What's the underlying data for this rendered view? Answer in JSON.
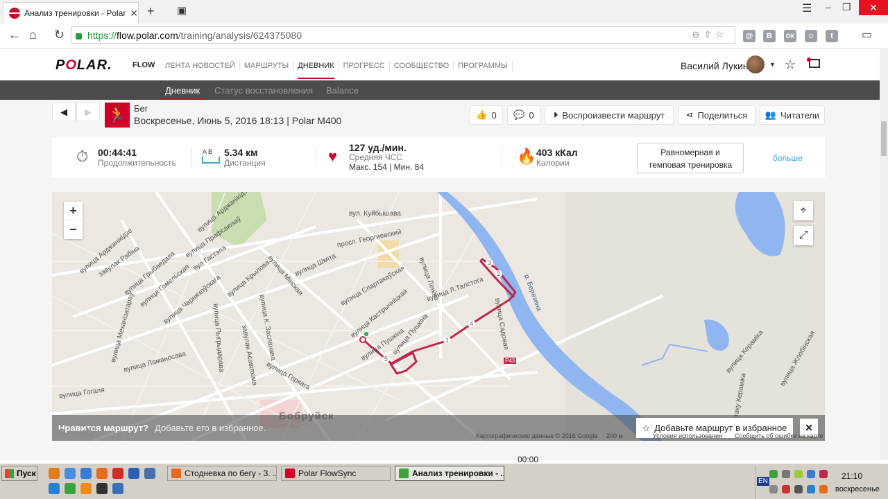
{
  "browser": {
    "tab_title": "Анализ тренировки - Polar F",
    "url_https": "https://",
    "url_host": "flow.polar.com",
    "url_path": "/training/analysis/624375080",
    "ext_letters": [
      "@",
      "В",
      "ОК",
      "",
      ""
    ]
  },
  "header": {
    "logo_pre": "P",
    "logo_o": "O",
    "logo_post": "LAR.",
    "flow": "FLOW",
    "nav": [
      "ЛЕНТА НОВОСТЕЙ",
      "МАРШРУТЫ",
      "ДНЕВНИК",
      "ПРОГРЕСС",
      "СООБЩЕСТВО",
      "ПРОГРАММЫ"
    ],
    "user_name": "Василий Лукин"
  },
  "subnav": [
    "Дневник",
    "Статус восстановления",
    "Balance"
  ],
  "session": {
    "sport": "Бег",
    "info": "Воскресенье, Июнь 5, 2016 18:13 | Polar M400",
    "likes": "0",
    "comments": "0",
    "replay_label": "Воспроизвести маршрут",
    "share_label": "Поделиться",
    "readers_label": "Читатели"
  },
  "summary": {
    "duration": "00:44:41",
    "duration_label": "Продолжительность",
    "distance": "5.34 км",
    "distance_label": "Дистанция",
    "ab_label": "A  B",
    "hr": "127 уд./мин.",
    "hr_label": "Средняя ЧСС",
    "hr_range": "Макс. 154  |  Мин. 84",
    "calories": "403 кКал",
    "calories_label": "Калории",
    "benefit_line1": "Равномерная и",
    "benefit_line2": "темповая тренировка",
    "more": "больше"
  },
  "map": {
    "city": "Бобруйск",
    "streets": [
      "просп. Георгиевский",
      "вулица Мінская",
      "вулица Кастрычніцкая",
      "вулица Спартакаўская",
      "вулица Пушкіна",
      "вулица Леніна",
      "вулица Л.Талстога",
      "вулица Крылова",
      "вулица Гогаля",
      "вулица Ламаносава",
      "вулица Горкага",
      "вулица Шміта",
      "вул. Куйбышава",
      "вулица Гомельская",
      "вулица Чарняхоўскага",
      "вулица Грыбаедава",
      "завулак Рабіна",
      "вулица Арджанікідзе",
      "вул Гастэла",
      "вулица Пушкіна",
      "вулица К. Засланава",
      "завулак Асавіяхіма",
      "вулица Пыгрыдарава",
      "вулица Садовая",
      "р. Березина",
      "вулица Механізатараў",
      "вулица Кераміка",
      "вулица Жлобінская",
      "Масцтаку Кераміка",
      "вулица Прафсаюзаў",
      "вулица Арджанікідзе",
      "Р43"
    ],
    "markers": [
      "1",
      "2",
      "3",
      "4",
      "5"
    ],
    "google": "Google",
    "map_data": "Картографические данные © 2016 Google",
    "scale": "200 м",
    "terms": "Условия использования",
    "report": "Сообщить об ошибке на карте",
    "fav_question": "Нравится маршрут?",
    "fav_desc": "Добавьте его в избранное.",
    "fav_button": "Добавьте маршрут в избранное"
  },
  "below_map": "00:00",
  "taskbar": {
    "start": "Пуск",
    "tasks": [
      "Стодневка по бегу - 3. ...",
      "Polar FlowSync",
      "Анализ тренировки - ..."
    ],
    "lang": "EN",
    "time": "21:10",
    "day": "воскресенье"
  },
  "colors": {
    "polar_red": "#d10027",
    "link_blue": "#3fa7dd",
    "route": "#c0254a",
    "river": "#8fb6f0"
  }
}
